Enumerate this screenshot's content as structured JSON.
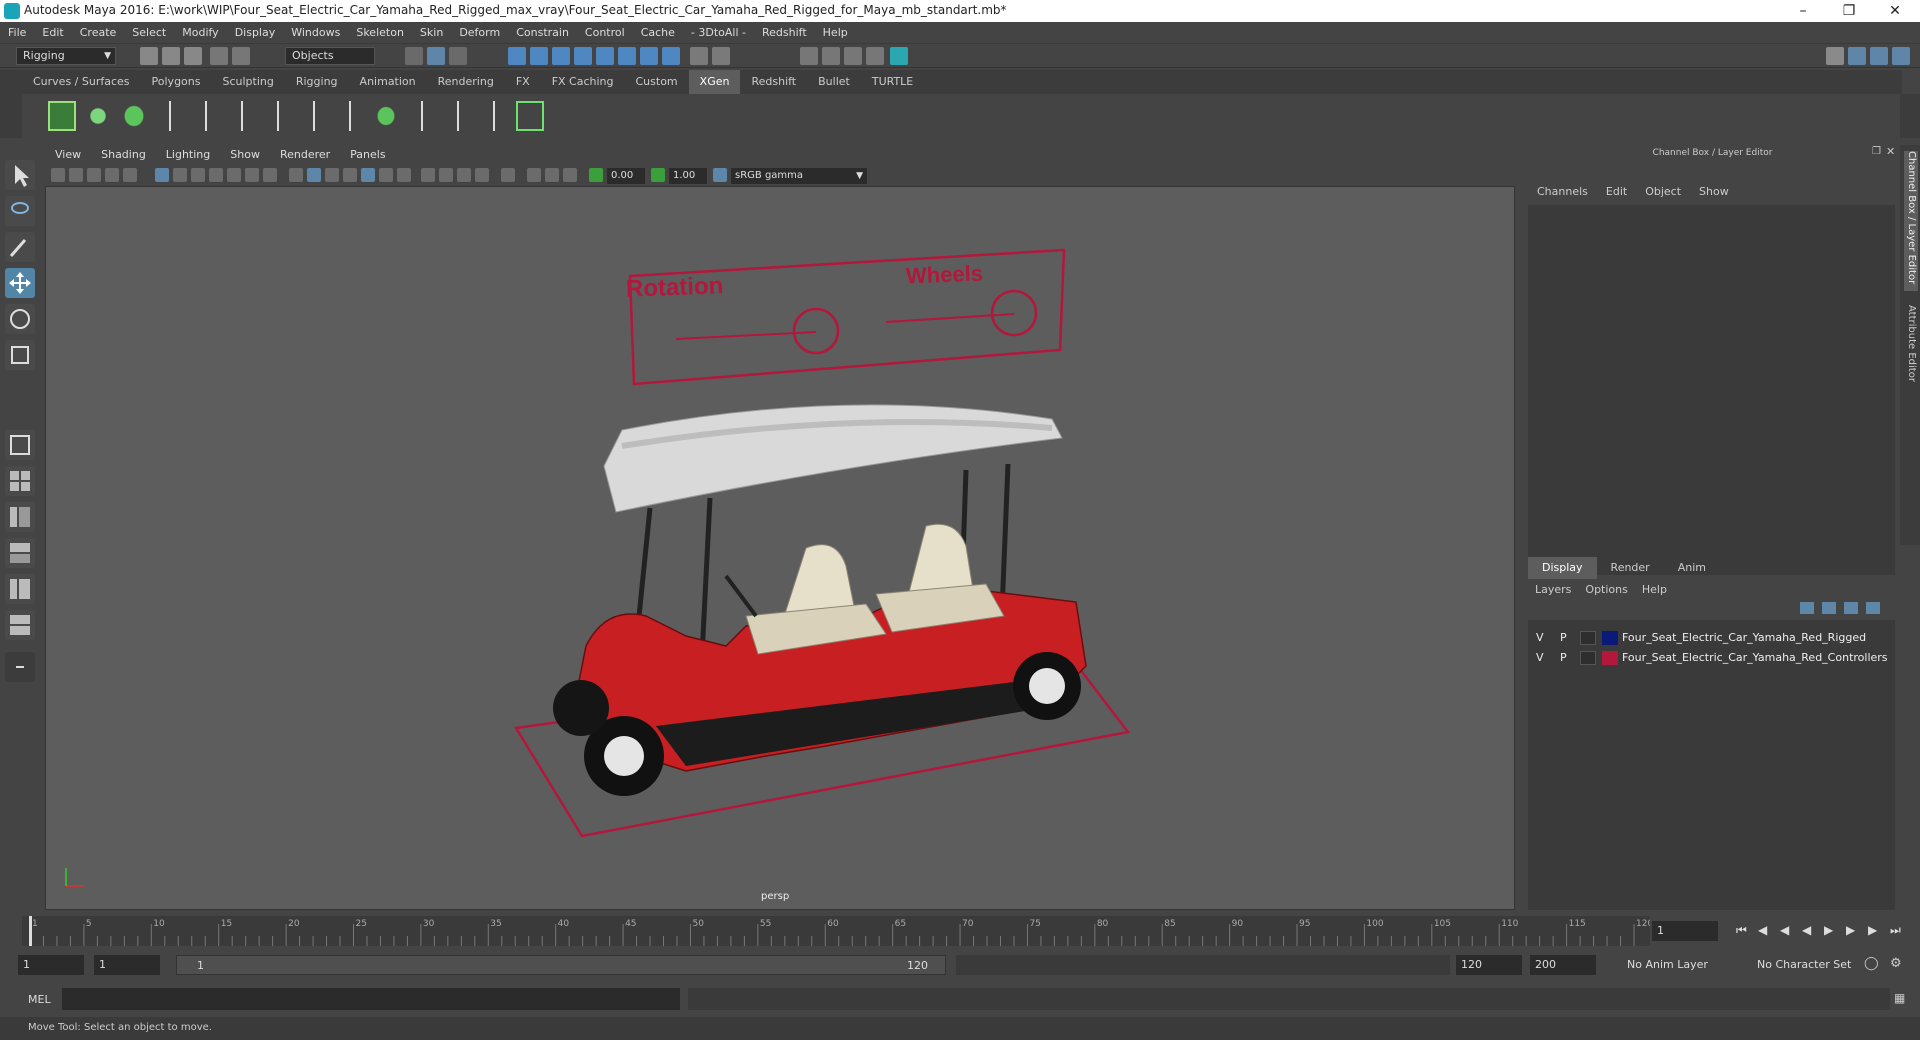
{
  "title": "Autodesk Maya 2016: E:\\work\\WIP\\Four_Seat_Electric_Car_Yamaha_Red_Rigged_max_vray\\Four_Seat_Electric_Car_Yamaha_Red_Rigged_for_Maya_mb_standart.mb*",
  "menu": [
    "File",
    "Edit",
    "Create",
    "Select",
    "Modify",
    "Display",
    "Windows",
    "Skeleton",
    "Skin",
    "Deform",
    "Constrain",
    "Control",
    "Cache",
    "- 3DtoAll -",
    "Redshift",
    "Help"
  ],
  "status": {
    "mode": "Rigging",
    "selection_mask": "Objects"
  },
  "shelf_tabs": [
    "Curves / Surfaces",
    "Polygons",
    "Sculpting",
    "Rigging",
    "Animation",
    "Rendering",
    "FX",
    "FX Caching",
    "Custom",
    "XGen",
    "Redshift",
    "Bullet",
    "TURTLE"
  ],
  "active_shelf_tab": "XGen",
  "viewport": {
    "menu": [
      "View",
      "Shading",
      "Lighting",
      "Show",
      "Renderer",
      "Panels"
    ],
    "field_a": "0.00",
    "field_b": "1.00",
    "colorspace": "sRGB gamma",
    "camera_label": "persp",
    "ctrl_rotation": "Rotation",
    "ctrl_wheels": "Wheels"
  },
  "panel": {
    "title": "Channel Box / Layer Editor",
    "channel_menu": [
      "Channels",
      "Edit",
      "Object",
      "Show"
    ],
    "layer_tabs": [
      "Display",
      "Render",
      "Anim"
    ],
    "layer_menu": [
      "Layers",
      "Options",
      "Help"
    ],
    "layers": [
      {
        "v": "V",
        "p": "P",
        "color": "#0b1a7a",
        "name": "Four_Seat_Electric_Car_Yamaha_Red_Rigged"
      },
      {
        "v": "V",
        "p": "P",
        "color": "#b3173c",
        "name": "Four_Seat_Electric_Car_Yamaha_Red_Controllers"
      }
    ],
    "side_tabs": [
      "Channel Box / Layer Editor",
      "Attribute Editor"
    ]
  },
  "timeline": {
    "ticks": [
      "1",
      "5",
      "10",
      "15",
      "20",
      "25",
      "30",
      "35",
      "40",
      "45",
      "50",
      "55",
      "60",
      "65",
      "70",
      "75",
      "80",
      "85",
      "90",
      "95",
      "100",
      "105",
      "110",
      "115",
      "120"
    ],
    "current_frame": "1"
  },
  "range": {
    "start": "1",
    "playback_start": "1",
    "slider_start": "1",
    "slider_end": "120",
    "playback_end": "120",
    "end": "200",
    "anim_layer": "No Anim Layer",
    "character_set": "No Character Set"
  },
  "cmd": {
    "label": "MEL"
  },
  "help_text": "Move Tool: Select an object to move."
}
